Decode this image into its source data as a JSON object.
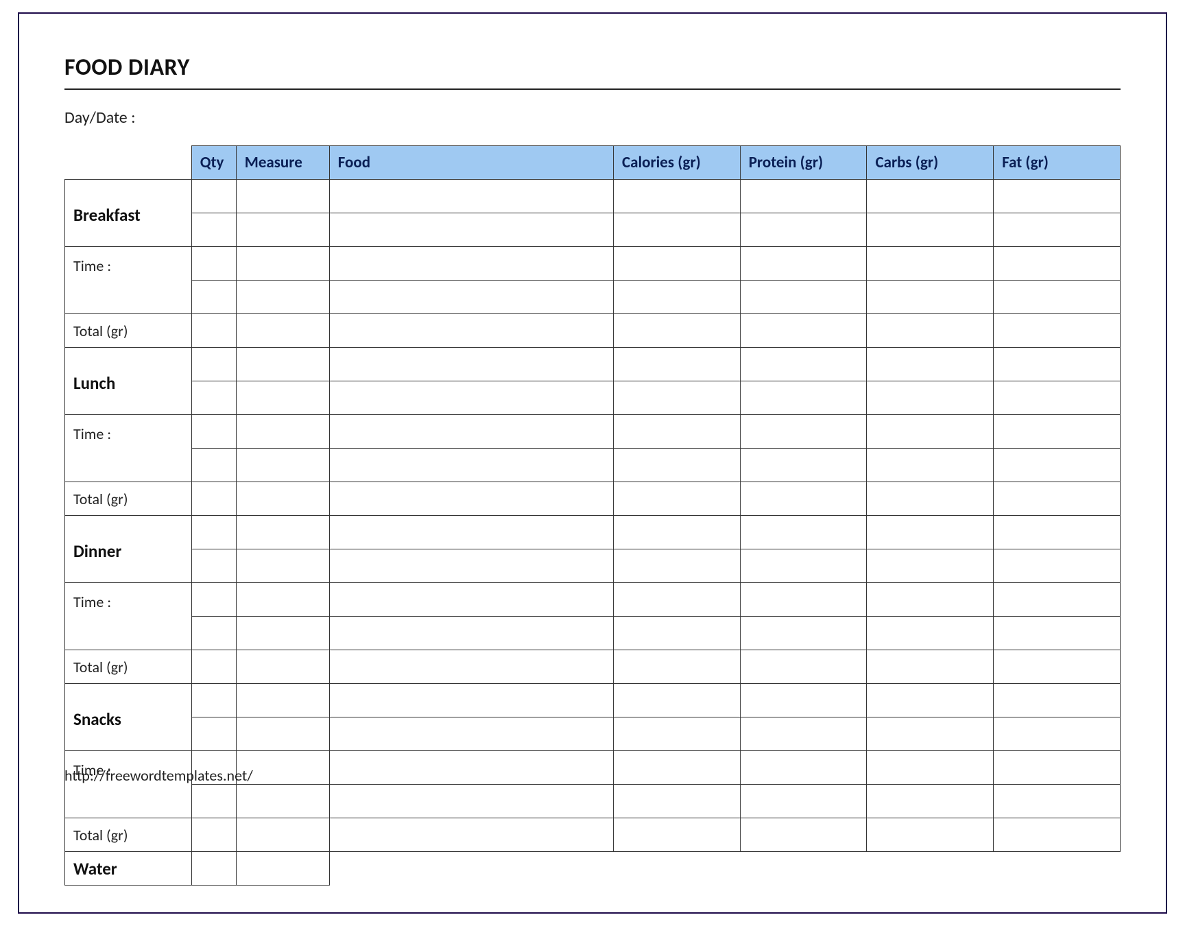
{
  "title": "FOOD DIARY",
  "day_date_label": "Day/Date :",
  "headers": {
    "qty": "Qty",
    "measure": "Measure",
    "food": "Food",
    "calories": "Calories (gr)",
    "protein": "Protein (gr)",
    "carbs": "Carbs (gr)",
    "fat": "Fat (gr)"
  },
  "meals": [
    {
      "name": "Breakfast",
      "time_label": "Time :",
      "total_label": "Total (gr)"
    },
    {
      "name": "Lunch",
      "time_label": "Time :",
      "total_label": "Total (gr)"
    },
    {
      "name": "Dinner",
      "time_label": "Time :",
      "total_label": "Total (gr)"
    },
    {
      "name": "Snacks",
      "time_label": "Time :",
      "total_label": "Total (gr)"
    }
  ],
  "water_label": "Water",
  "footer_url": "http://freewordtemplates.net/"
}
